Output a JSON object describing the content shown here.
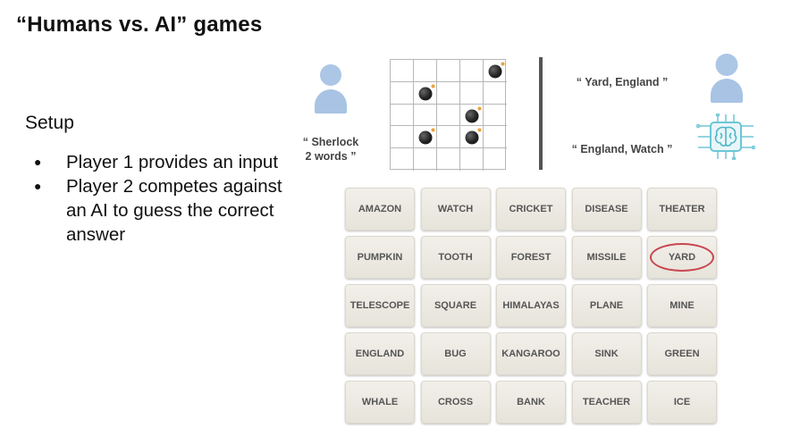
{
  "slide": {
    "title": "“Humans vs. AI” games",
    "setup_heading": "Setup",
    "bullets": [
      "Player 1 provides an input",
      "Player 2 competes against an AI to guess the correct answer"
    ],
    "bullet_marker": "●"
  },
  "figure": {
    "player1_clue_line1": "“ Sherlock",
    "player1_clue_line2": "2 words ”",
    "human_guess": "“ Yard, England ”",
    "ai_guess": "“ England, Watch ”",
    "bomb_cells": [
      [
        0,
        4
      ],
      [
        1,
        1
      ],
      [
        2,
        3
      ],
      [
        3,
        1
      ],
      [
        3,
        3
      ]
    ],
    "person_color": "#a8c3e4",
    "ai_icon_color": "#6cc6d6"
  },
  "board": {
    "circled_word": "YARD",
    "circle_color": "#c9454f",
    "words": [
      "AMAZON",
      "WATCH",
      "CRICKET",
      "DISEASE",
      "THEATER",
      "PUMPKIN",
      "TOOTH",
      "FOREST",
      "MISSILE",
      "YARD",
      "TELESCOPE",
      "SQUARE",
      "HIMALAYAS",
      "PLANE",
      "MINE",
      "ENGLAND",
      "BUG",
      "KANGAROO",
      "SINK",
      "GREEN",
      "WHALE",
      "CROSS",
      "BANK",
      "TEACHER",
      "ICE"
    ]
  }
}
